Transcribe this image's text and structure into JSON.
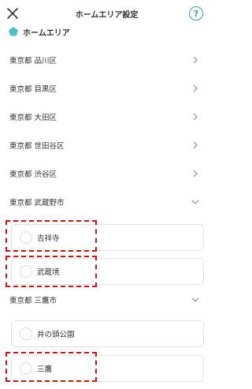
{
  "header": {
    "title": "ホームエリア設定",
    "close_icon": "close-icon",
    "help_label": "?"
  },
  "section": {
    "icon": "pentagon-icon",
    "icon_color": "#4fbfc4",
    "title": "ホームエリア"
  },
  "areas": [
    {
      "label": "東京都 品川区",
      "state": "collapsed"
    },
    {
      "label": "東京都 目黒区",
      "state": "collapsed"
    },
    {
      "label": "東京都 大田区",
      "state": "collapsed"
    },
    {
      "label": "東京都 世田谷区",
      "state": "collapsed"
    },
    {
      "label": "東京都 渋谷区",
      "state": "collapsed"
    },
    {
      "label": "東京都 武蔵野市",
      "state": "expanded"
    },
    {
      "label": "東京都 三鷹市",
      "state": "expanded"
    }
  ],
  "musashino_options": [
    {
      "label": "吉祥寺",
      "selected": false
    },
    {
      "label": "武蔵境",
      "selected": false
    }
  ],
  "mitaka_options": [
    {
      "label": "井の頭公園",
      "selected": false
    },
    {
      "label": "三鷹",
      "selected": false
    }
  ],
  "colors": {
    "accent": "#3a9aa6",
    "highlight_border": "#cc1111"
  }
}
